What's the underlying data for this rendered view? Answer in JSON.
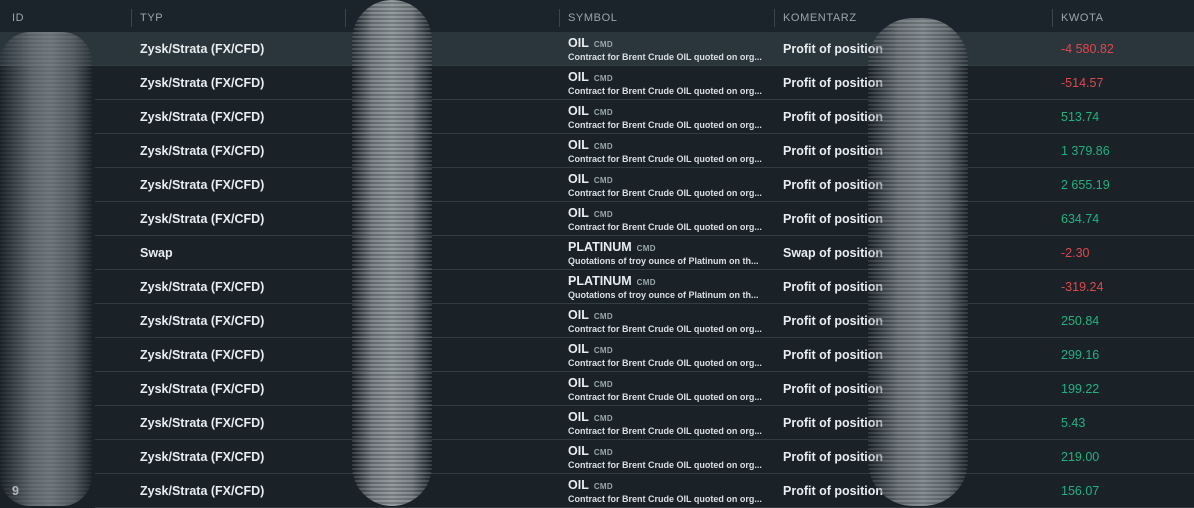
{
  "columns": {
    "id": "ID",
    "typ": "TYP",
    "symbol": "SYMBOL",
    "komentarz": "KOMENTARZ",
    "kwota": "KWOTA"
  },
  "rows": [
    {
      "id": "",
      "typ": "Zysk/Strata (FX/CFD)",
      "symbol": "OIL",
      "tag": "CMD",
      "desc": "Contract for Brent Crude OIL quoted on org...",
      "komentarz": "Profit of position",
      "kwota": "-4 580.82",
      "sign": "neg"
    },
    {
      "id": "",
      "typ": "Zysk/Strata (FX/CFD)",
      "symbol": "OIL",
      "tag": "CMD",
      "desc": "Contract for Brent Crude OIL quoted on org...",
      "komentarz": "Profit of position",
      "kwota": "-514.57",
      "sign": "neg"
    },
    {
      "id": "",
      "typ": "Zysk/Strata (FX/CFD)",
      "symbol": "OIL",
      "tag": "CMD",
      "desc": "Contract for Brent Crude OIL quoted on org...",
      "komentarz": "Profit of position",
      "kwota": "513.74",
      "sign": "pos"
    },
    {
      "id": "",
      "typ": "Zysk/Strata (FX/CFD)",
      "symbol": "OIL",
      "tag": "CMD",
      "desc": "Contract for Brent Crude OIL quoted on org...",
      "komentarz": "Profit of position",
      "kwota": "1 379.86",
      "sign": "pos"
    },
    {
      "id": "",
      "typ": "Zysk/Strata (FX/CFD)",
      "symbol": "OIL",
      "tag": "CMD",
      "desc": "Contract for Brent Crude OIL quoted on org...",
      "komentarz": "Profit of position",
      "kwota": "2 655.19",
      "sign": "pos"
    },
    {
      "id": "",
      "typ": "Zysk/Strata (FX/CFD)",
      "symbol": "OIL",
      "tag": "CMD",
      "desc": "Contract for Brent Crude OIL quoted on org...",
      "komentarz": "Profit of position",
      "kwota": "634.74",
      "sign": "pos"
    },
    {
      "id": "",
      "typ": "Swap",
      "symbol": "PLATINUM",
      "tag": "CMD",
      "desc": "Quotations of troy ounce of Platinum on th...",
      "komentarz": "Swap of position",
      "kwota": "-2.30",
      "sign": "neg"
    },
    {
      "id": "",
      "typ": "Zysk/Strata (FX/CFD)",
      "symbol": "PLATINUM",
      "tag": "CMD",
      "desc": "Quotations of troy ounce of Platinum on th...",
      "komentarz": "Profit of position",
      "kwota": "-319.24",
      "sign": "neg"
    },
    {
      "id": "",
      "typ": "Zysk/Strata (FX/CFD)",
      "symbol": "OIL",
      "tag": "CMD",
      "desc": "Contract for Brent Crude OIL quoted on org...",
      "komentarz": "Profit of position",
      "kwota": "250.84",
      "sign": "pos"
    },
    {
      "id": "",
      "typ": "Zysk/Strata (FX/CFD)",
      "symbol": "OIL",
      "tag": "CMD",
      "desc": "Contract for Brent Crude OIL quoted on org...",
      "komentarz": "Profit of position",
      "kwota": "299.16",
      "sign": "pos"
    },
    {
      "id": "",
      "typ": "Zysk/Strata (FX/CFD)",
      "symbol": "OIL",
      "tag": "CMD",
      "desc": "Contract for Brent Crude OIL quoted on org...",
      "komentarz": "Profit of position",
      "kwota": "199.22",
      "sign": "pos"
    },
    {
      "id": "",
      "typ": "Zysk/Strata (FX/CFD)",
      "symbol": "OIL",
      "tag": "CMD",
      "desc": "Contract for Brent Crude OIL quoted on org...",
      "komentarz": "Profit of position",
      "kwota": "5.43",
      "sign": "pos"
    },
    {
      "id": "",
      "typ": "Zysk/Strata (FX/CFD)",
      "symbol": "OIL",
      "tag": "CMD",
      "desc": "Contract for Brent Crude OIL quoted on org...",
      "komentarz": "Profit of position",
      "kwota": "219.00",
      "sign": "pos"
    },
    {
      "id": "9",
      "typ": "Zysk/Strata (FX/CFD)",
      "symbol": "OIL",
      "tag": "CMD",
      "desc": "Contract for Brent Crude OIL quoted on org...",
      "komentarz": "Profit of position",
      "kwota": "156.07",
      "sign": "pos"
    }
  ],
  "colors": {
    "background": "#1a2228",
    "selected_row": "#2b353c",
    "negative": "#e0474c",
    "positive": "#1fb27e"
  }
}
